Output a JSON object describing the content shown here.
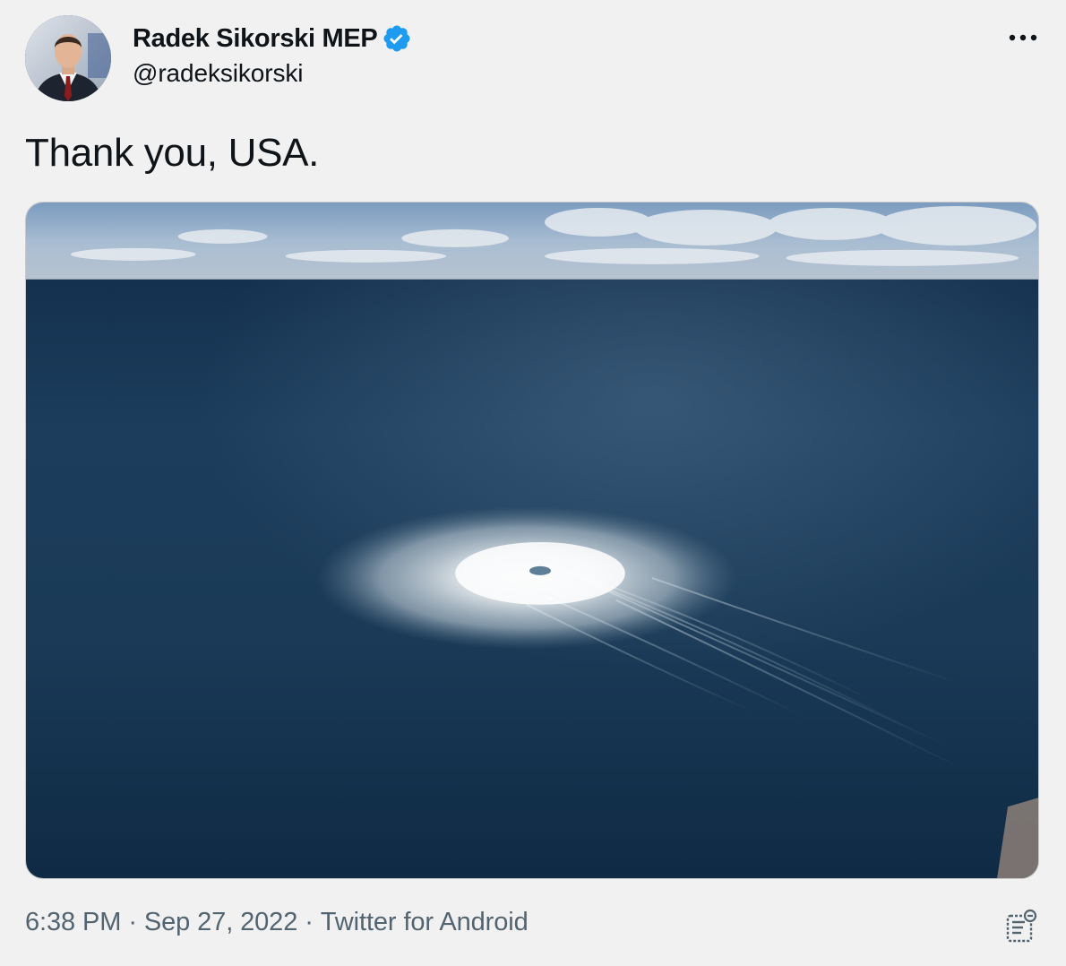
{
  "author": {
    "display_name": "Radek Sikorski MEP",
    "handle": "@radeksikorski",
    "verified": true,
    "avatar_icon": "profile-photo"
  },
  "tweet": {
    "text": "Thank you, USA.",
    "media": {
      "type": "photo",
      "alt": "Aerial photo of a large gas leak bubbling at the sea surface"
    }
  },
  "meta": {
    "time": "6:38 PM",
    "separator": "·",
    "date": "Sep 27, 2022",
    "source": "Twitter for Android"
  },
  "icons": {
    "more": "more-horizontal-icon",
    "verified": "verified-badge-icon",
    "analytics": "view-analytics-icon"
  },
  "colors": {
    "background": "#f1f1f1",
    "text": "#0f1419",
    "secondary_text": "#536471",
    "verified_blue": "#1d9bf0"
  }
}
